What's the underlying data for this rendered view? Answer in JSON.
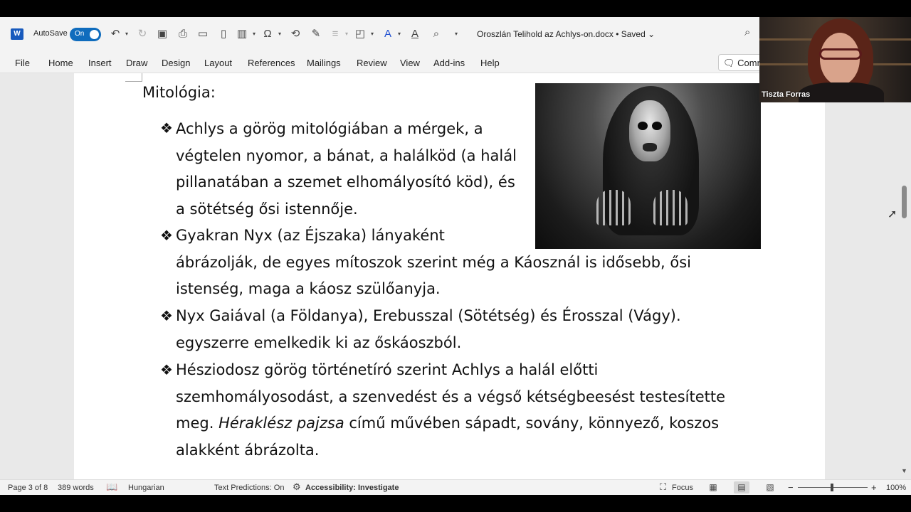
{
  "titlebar": {
    "app_logo": "W",
    "autosave_label": "AutoSave",
    "autosave_state": "On",
    "document_title": "Oroszlán Telihold az Achlys-on.docx • Saved ⌄",
    "icons": [
      "undo-icon",
      "redo-icon",
      "save-icon",
      "print-icon",
      "open-icon",
      "new-icon",
      "columns-icon",
      "symbol-icon",
      "format-painter-icon",
      "track-changes-icon",
      "shapes-icon",
      "font-color-icon",
      "underline-icon",
      "search-icon",
      "customize-icon"
    ]
  },
  "ribbon": {
    "tabs": [
      "File",
      "Home",
      "Insert",
      "Draw",
      "Design",
      "Layout",
      "References",
      "Mailings",
      "Review",
      "View",
      "Add-ins",
      "Help"
    ],
    "comments_label": "Comments"
  },
  "document": {
    "heading": "Mitológia:",
    "bullet_symbol": "❖",
    "p1": [
      "Achlys a görög mitológiában a mérgek, a",
      "végtelen nyomor, a bánat, a halálköd (a halál",
      "pillanatában a szemet elhomályosító köd), és",
      "a sötétség ősi istennője."
    ],
    "p2": [
      "Gyakran Nyx (az Éjszaka) lányaként",
      "ábrázolják, de egyes mítoszok szerint még a Káosznál is idősebb, ősi",
      "istenség, maga a káosz szülőanyja."
    ],
    "p3": [
      "Nyx Gaiával (a Földanya), Erebusszal (Sötétség) és Érosszal (Vágy).",
      "egyszerre emelkedik ki az őskáoszból."
    ],
    "p4": {
      "line1": "Hésziodosz görög történetíró szerint Achlys a halál előtti",
      "line2": "szemhomályosodást, a szenvedést és a végső kétségbeesést testesítette",
      "line3_start": "meg. ",
      "line3_italic": "Héraklész pajzsa",
      "line3_end": " című művében sápadt, sovány, könnyező, koszos",
      "line4": "alakként ábrázolta."
    }
  },
  "webcam": {
    "participant_name": "Tiszta Forras"
  },
  "statusbar": {
    "page": "Page 3 of 8",
    "words": "389 words",
    "language": "Hungarian",
    "text_predictions": "Text Predictions: On",
    "accessibility": "Accessibility: Investigate",
    "focus": "Focus",
    "zoom": "100%",
    "zoom_minus": "−",
    "zoom_plus": "+"
  },
  "colors": {
    "accent": "#0f6cbd",
    "word_blue": "#185abd",
    "chrome_bg": "#f3f3f3",
    "workarea_bg": "#e9e9e9"
  }
}
